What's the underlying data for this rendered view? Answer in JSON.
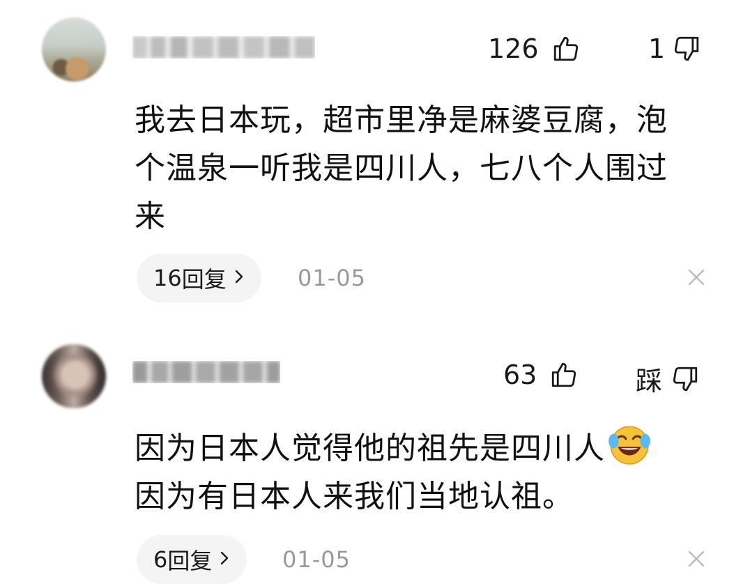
{
  "comments": [
    {
      "username": "",
      "likes": "126",
      "dislikes": "1",
      "text_lines": [
        "我去日本玩，超市里净是麻婆豆腐，泡",
        "个温泉一听我是四川人，七八个人围过",
        "来"
      ],
      "reply_count": "16",
      "reply_label": "回复",
      "date": "01-05",
      "icons": [
        "thumbs-up-icon",
        "thumbs-down-icon",
        "close-icon",
        "chevron-right-icon"
      ]
    },
    {
      "username": "",
      "likes": "63",
      "dislikes": "踩",
      "text_lines": [
        "因为日本人觉得他的祖先是四川人",
        "因为有日本人来我们当地认祖。"
      ],
      "emoji": "laughing-crying-emoji",
      "reply_count": "6",
      "reply_label": "回复",
      "date": "01-05",
      "icons": [
        "thumbs-up-icon",
        "thumbs-down-icon",
        "close-icon",
        "chevron-right-icon"
      ]
    }
  ],
  "colors": {
    "text": "#111111",
    "secondary": "#999999",
    "pill_bg": "#f4f4f4",
    "icon": "#1a1a1a"
  }
}
